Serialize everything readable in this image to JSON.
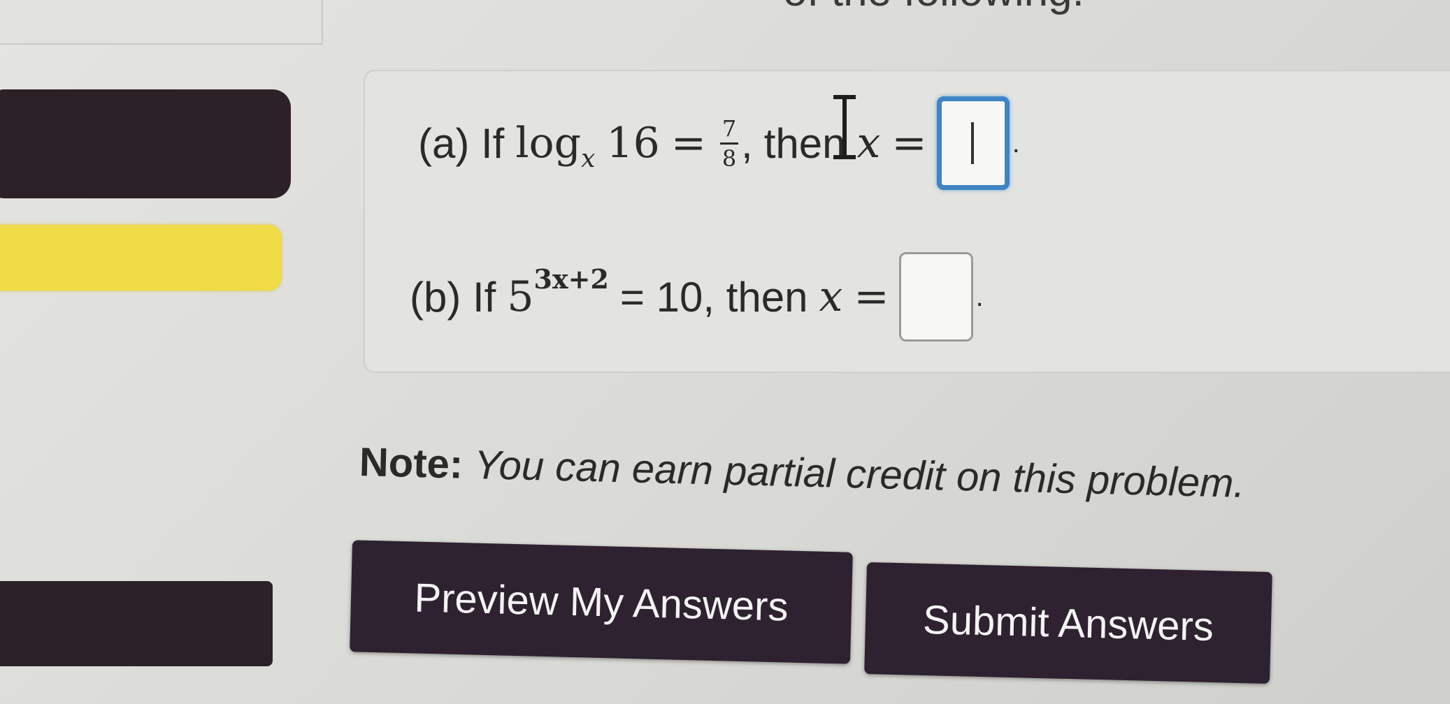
{
  "header": {
    "intro_text": "of the following."
  },
  "problem": {
    "part_a": {
      "label": "(a) If",
      "log_word": "log",
      "log_base": "x",
      "log_arg": "16",
      "equals": "=",
      "frac_num": "7",
      "frac_den": "8",
      "comma": ",",
      "then_text": "then",
      "var": "x",
      "equals2": "=",
      "answer_value": "",
      "period": "."
    },
    "part_b": {
      "label": "(b) If",
      "base": "5",
      "exponent": "3x+2",
      "rhs": "= 10, then",
      "var": "x",
      "equals": "=",
      "answer_value": "",
      "period": "."
    }
  },
  "note": {
    "label": "Note:",
    "body": "You can earn partial credit on this problem."
  },
  "buttons": {
    "preview_label": "Preview My Answers",
    "submit_label": "Submit Answers"
  },
  "colors": {
    "sidebar_dark": "#2d2128",
    "sidebar_highlight": "#f0dc46",
    "focus_border": "#3f84c4",
    "button_bg": "#2f2230"
  }
}
